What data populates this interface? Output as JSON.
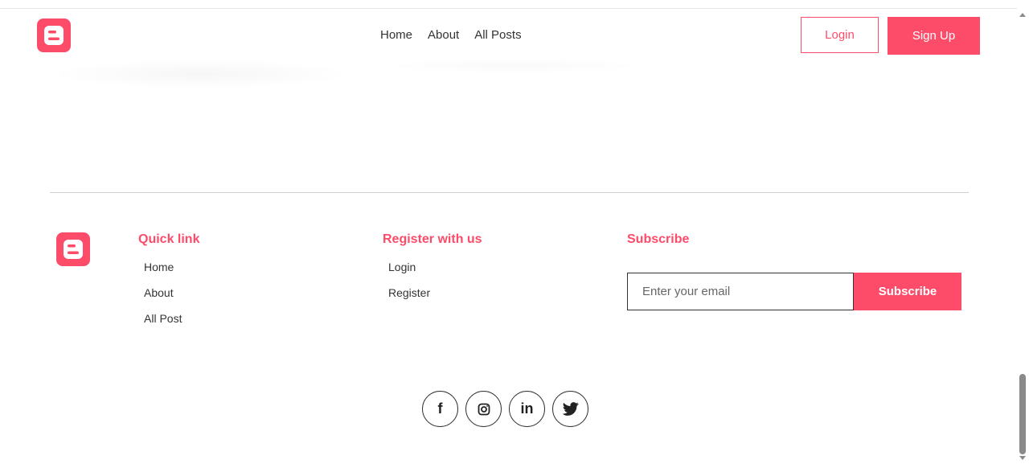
{
  "colors": {
    "accent": "#fd4b6a",
    "text": "#333333"
  },
  "nav": {
    "logo_icon": "blogger-icon",
    "links": [
      "Home",
      "About",
      "All Posts"
    ],
    "login_label": "Login",
    "signup_label": "Sign Up"
  },
  "footer": {
    "logo_icon": "blogger-icon",
    "quick_link": {
      "heading": "Quick link",
      "items": [
        "Home",
        "About",
        "All Post"
      ]
    },
    "register": {
      "heading": "Register with us",
      "items": [
        "Login",
        "Register"
      ]
    },
    "subscribe": {
      "heading": "Subscribe",
      "email_placeholder": "Enter your email",
      "button_label": "Subscribe"
    },
    "socials": [
      {
        "icon": "facebook-icon",
        "glyph": "f"
      },
      {
        "icon": "instagram-icon",
        "glyph": ""
      },
      {
        "icon": "linkedin-icon",
        "glyph": "in"
      },
      {
        "icon": "twitter-icon",
        "glyph": ""
      }
    ]
  }
}
